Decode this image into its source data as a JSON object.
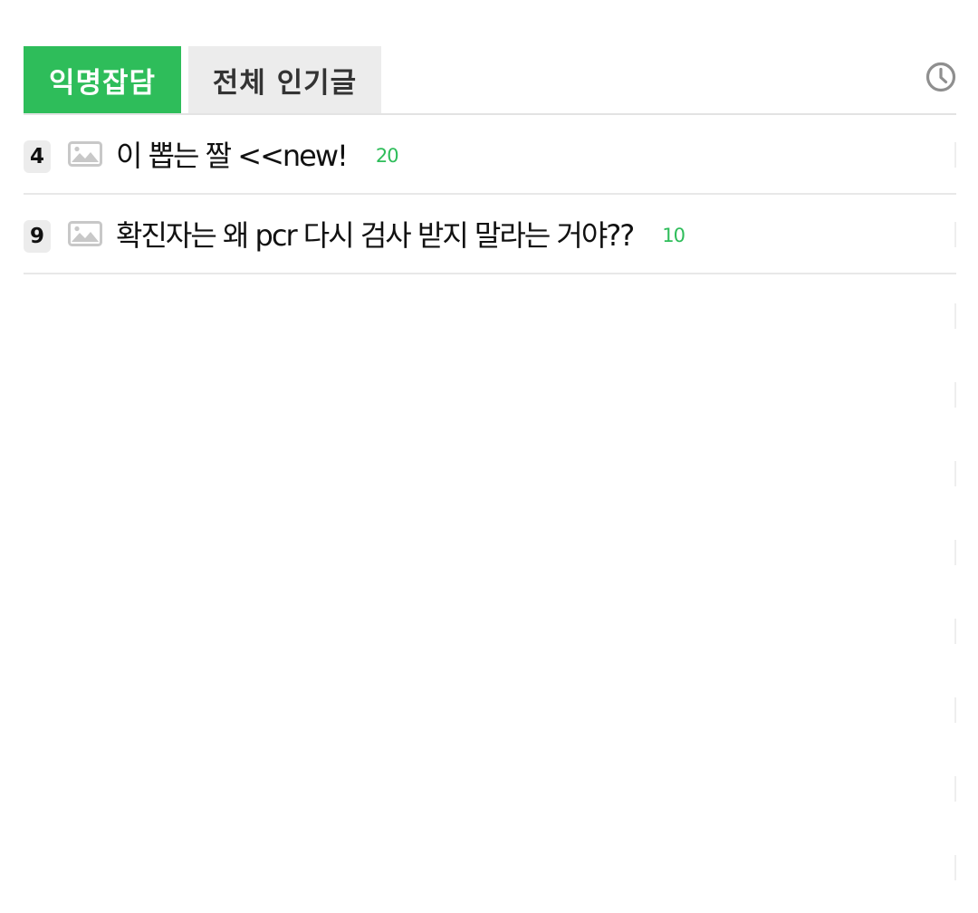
{
  "tabs": [
    {
      "label": "익명잡담",
      "active": true
    },
    {
      "label": "전체 인기글",
      "active": false
    }
  ],
  "header": {
    "history_icon": "clock-icon"
  },
  "posts": [
    {
      "rank": "4",
      "icon": "image-icon",
      "title": "이 뽑는 짤 <<new!",
      "comments": "20"
    },
    {
      "rank": "9",
      "icon": "image-icon",
      "title": "확진자는 왜 pcr 다시 검사 받지 말라는 거야??",
      "comments": "10"
    }
  ],
  "colors": {
    "accent": "#2ebd5a",
    "tab_inactive_bg": "#ececec",
    "divider": "#e3e3e3",
    "icon_gray": "#c8c8c8"
  }
}
